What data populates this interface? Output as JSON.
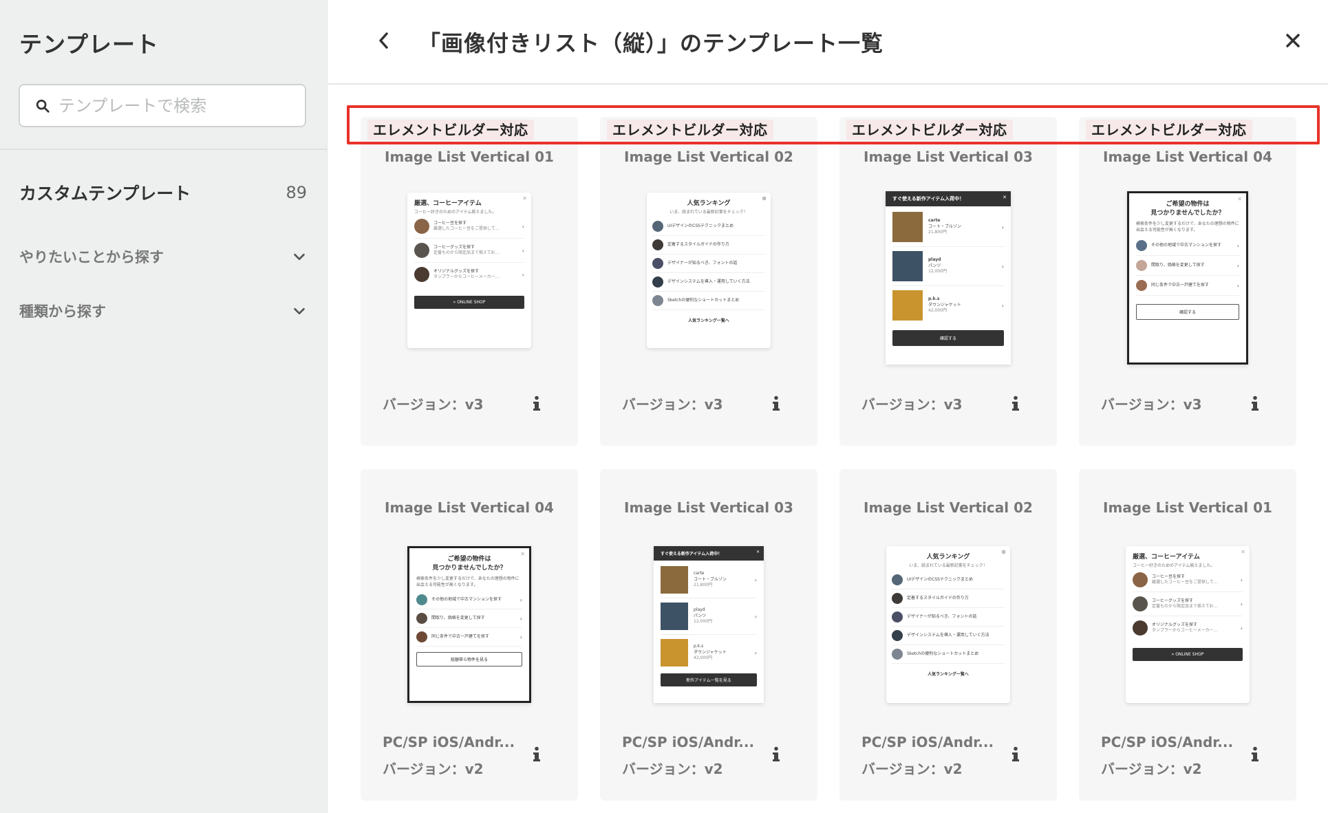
{
  "sidebar": {
    "title": "テンプレート",
    "search_placeholder": "テンプレートで検索",
    "custom": {
      "label": "カスタムテンプレート",
      "count": "89"
    },
    "sections": [
      {
        "label": "やりたいことから探す"
      },
      {
        "label": "種類から探す"
      }
    ]
  },
  "header": {
    "title": "「画像付きリスト（縦）」のテンプレート一覧"
  },
  "cards_row1": [
    {
      "badge": "エレメントビルダー対応",
      "name": "Image List Vertical 01",
      "version": "バージョン：v3"
    },
    {
      "badge": "エレメントビルダー対応",
      "name": "Image List Vertical 02",
      "version": "バージョン：v3"
    },
    {
      "badge": "エレメントビルダー対応",
      "name": "Image List Vertical 03",
      "version": "バージョン：v3"
    },
    {
      "badge": "エレメントビルダー対応",
      "name": "Image List Vertical 04",
      "version": "バージョン：v3"
    }
  ],
  "cards_row2": [
    {
      "name": "Image List Vertical 04",
      "platform": "PC/SP iOS/Andr...",
      "version": "バージョン：v2"
    },
    {
      "name": "Image List Vertical 03",
      "platform": "PC/SP iOS/Andr...",
      "version": "バージョン：v2"
    },
    {
      "name": "Image List Vertical 02",
      "platform": "PC/SP iOS/Andr...",
      "version": "バージョン：v2"
    },
    {
      "name": "Image List Vertical 01",
      "platform": "PC/SP iOS/Andr...",
      "version": "バージョン：v2"
    }
  ],
  "previews": {
    "coffee": {
      "title": "厳選、コーヒーアイテム",
      "subtitle": "コーヒー好きのためのアイテム揃えました。",
      "items": [
        {
          "title": "コーヒー豆を探す",
          "desc": "厳選したコーヒー豆をご提供して..."
        },
        {
          "title": "コーヒーグッズを探す",
          "desc": "定番ものから限定品まで揃えてお..."
        },
        {
          "title": "オリジナルグッズを探す",
          "desc": "タンブラーからコーヒーメーカー..."
        }
      ],
      "button": "» ONLINE SHOP"
    },
    "ranking": {
      "title": "人気ランキング",
      "subtitle": "いま、読まれている最新記事をチェック！",
      "items": [
        "UIデザインのCSSテクニックまとめ",
        "定着するスタイルガイドの作り方",
        "デザイナーが知るべき、フォントの話",
        "デザインシステムを導入・運用していく方法",
        "Sketchの便利なショートカットまとめ"
      ],
      "link": "人気ランキング一覧へ"
    },
    "fashion": {
      "header": "すぐ使える新作アイテム入荷中！",
      "items": [
        {
          "brand": "carte",
          "name": "コート・ブルゾン",
          "price": "21,800円"
        },
        {
          "brand": "playd",
          "name": "パンツ",
          "price": "12,000円"
        },
        {
          "brand": "p.k.s",
          "name": "ダウンジャケット",
          "price": "42,000円"
        }
      ],
      "button_v3": "確認する",
      "button_v2": "新作アイテム一覧を見る"
    },
    "estate": {
      "title_line1": "ご希望の物件は",
      "title_line2": "見つかりませんでしたか？",
      "desc": "検索条件を少し変更するだけで、あなたの理想の物件に出会える可能性が高くなります。",
      "items": [
        "その他の地域で中古マンションを探す",
        "間取り、価格を変更して探す",
        "同じ条件で中古一戸建てを探す"
      ],
      "button_v3": "確認する",
      "button_v2": "総額帯ら物件を見る"
    }
  },
  "colors": {
    "highlight": "#e8322a",
    "badge_bg": "#f7e9e9",
    "sidebar_bg": "#eef0ef",
    "card_bg": "#f6f6f6"
  },
  "icons": {
    "search": "search-icon",
    "back": "chevron-left-icon",
    "close": "close-icon",
    "info": "info-icon",
    "expand": "chevron-down-icon"
  }
}
